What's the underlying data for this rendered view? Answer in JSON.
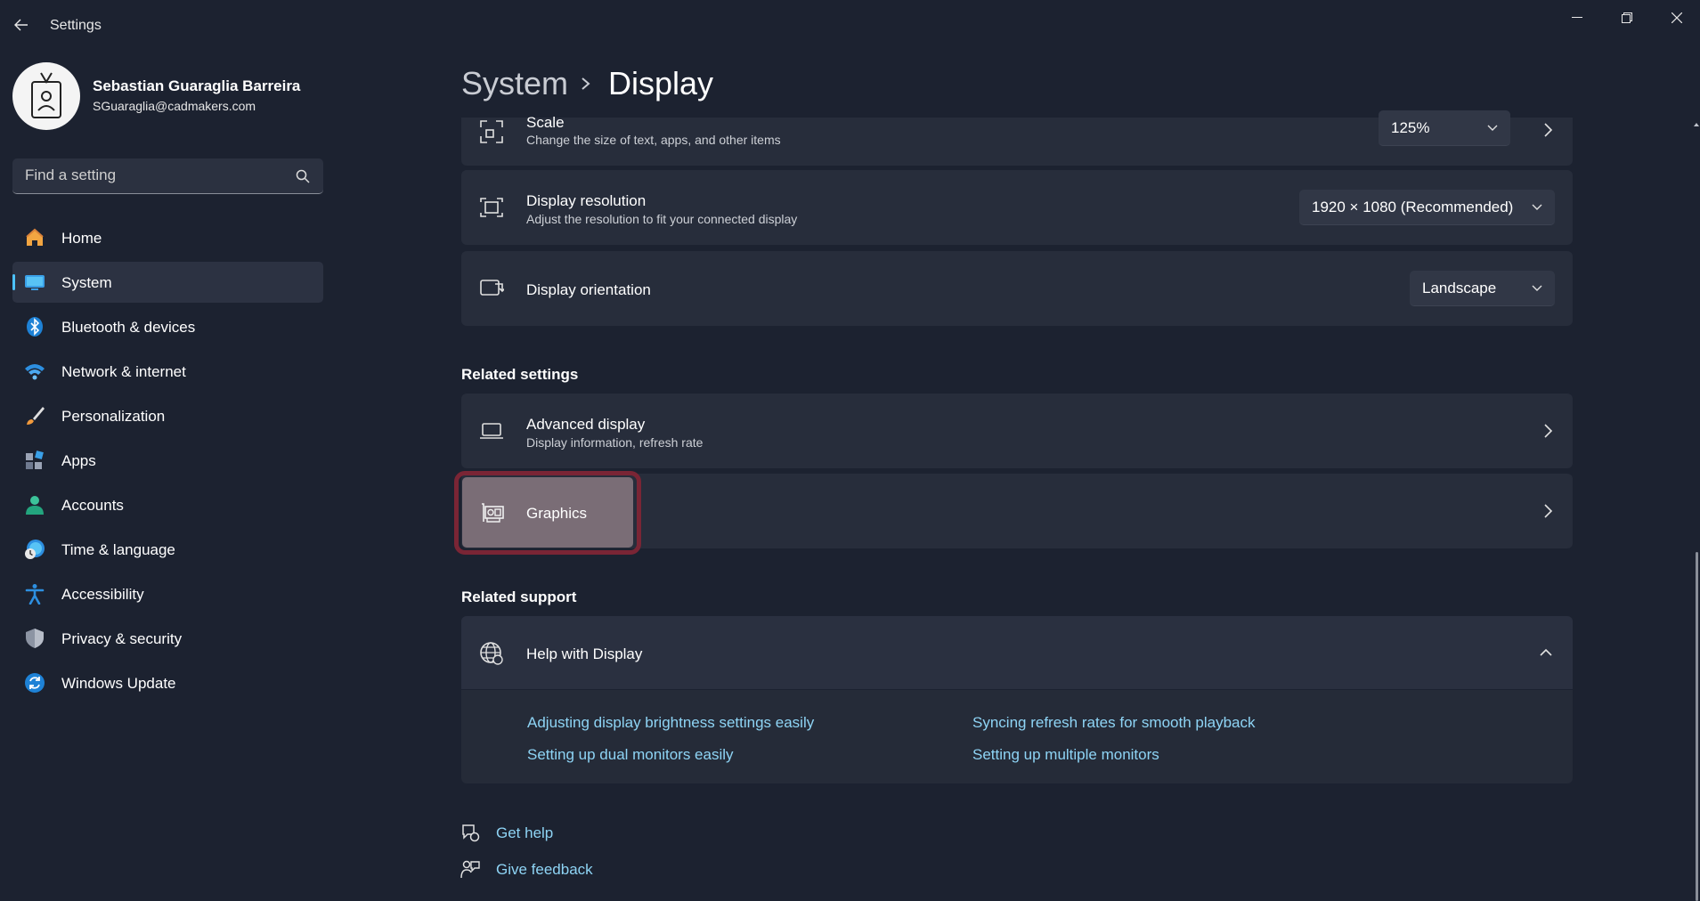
{
  "app": {
    "title": "Settings"
  },
  "profile": {
    "name": "Sebastian Guaraglia Barreira",
    "email": "SGuaraglia@cadmakers.com"
  },
  "search": {
    "placeholder": "Find a setting"
  },
  "sidebar": {
    "items": [
      {
        "label": "Home",
        "icon": "home-icon",
        "active": false
      },
      {
        "label": "System",
        "icon": "system-icon",
        "active": true
      },
      {
        "label": "Bluetooth & devices",
        "icon": "bluetooth-icon",
        "active": false
      },
      {
        "label": "Network & internet",
        "icon": "wifi-icon",
        "active": false
      },
      {
        "label": "Personalization",
        "icon": "brush-icon",
        "active": false
      },
      {
        "label": "Apps",
        "icon": "apps-icon",
        "active": false
      },
      {
        "label": "Accounts",
        "icon": "accounts-icon",
        "active": false
      },
      {
        "label": "Time & language",
        "icon": "time-language-icon",
        "active": false
      },
      {
        "label": "Accessibility",
        "icon": "accessibility-icon",
        "active": false
      },
      {
        "label": "Privacy & security",
        "icon": "shield-icon",
        "active": false
      },
      {
        "label": "Windows Update",
        "icon": "update-icon",
        "active": false
      }
    ]
  },
  "breadcrumb": {
    "root": "System",
    "current": "Display"
  },
  "scale": {
    "title": "Scale",
    "subtitle": "Change the size of text, apps, and other items",
    "value": "125%"
  },
  "resolution": {
    "title": "Display resolution",
    "subtitle": "Adjust the resolution to fit your connected display",
    "value": "1920 × 1080 (Recommended)"
  },
  "orientation": {
    "title": "Display orientation",
    "value": "Landscape"
  },
  "related_settings": {
    "heading": "Related settings",
    "advanced": {
      "title": "Advanced display",
      "subtitle": "Display information, refresh rate"
    },
    "graphics": {
      "title": "Graphics"
    }
  },
  "related_support": {
    "heading": "Related support",
    "help_title": "Help with Display",
    "links": [
      "Adjusting display brightness settings easily",
      "Syncing refresh rates for smooth playback",
      "Setting up dual monitors easily",
      "Setting up multiple monitors"
    ]
  },
  "footer": {
    "get_help": "Get help",
    "give_feedback": "Give feedback"
  },
  "colors": {
    "accent": "#4cc2ff",
    "link": "#8ed4f5",
    "background": "#1c2230",
    "card": "#272d3b",
    "highlight_border": "#7a2535"
  }
}
